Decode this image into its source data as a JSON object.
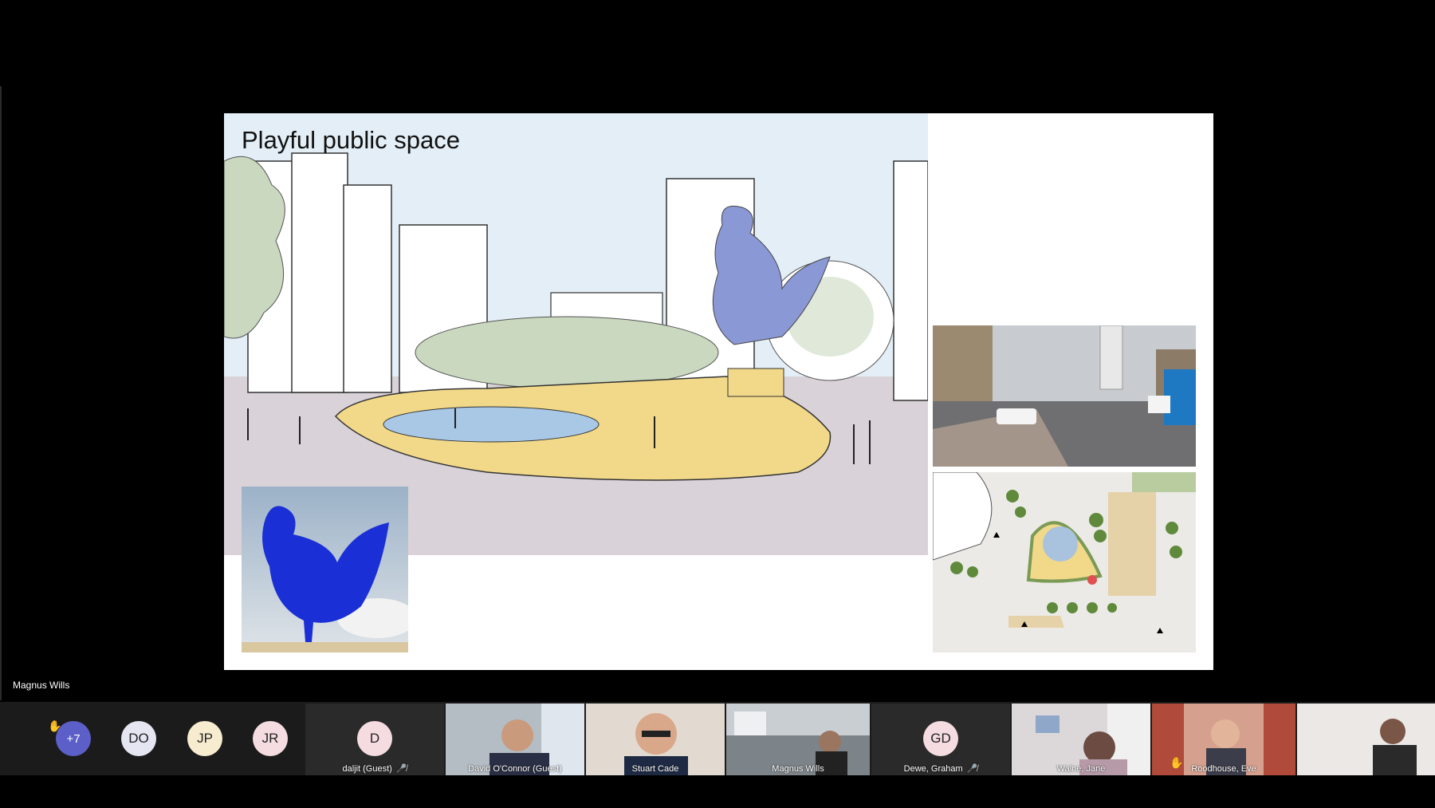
{
  "slide": {
    "title": "Playful public space"
  },
  "presenter_name": "Magnus Wills",
  "overflow_count": "+7",
  "avatars": [
    {
      "initials": "DO",
      "color": "#e6e6f3"
    },
    {
      "initials": "JP",
      "color": "#f7ecd0"
    },
    {
      "initials": "JR",
      "color": "#f5dce0"
    }
  ],
  "participants": [
    {
      "name": "daljit (Guest)",
      "initials": "D",
      "muted": true
    },
    {
      "name": "David O'Connor (Guest)"
    },
    {
      "name": "Stuart Cade"
    },
    {
      "name": "Magnus Wills"
    },
    {
      "name": "Dewe, Graham",
      "initials": "GD",
      "muted": true
    },
    {
      "name": "Walne, Jane"
    },
    {
      "name": "Roodhouse, Eve",
      "hand": true
    }
  ],
  "colors": {
    "accent_overflow": "#5b5fc7",
    "sculpture_blue": "#1a2fd6",
    "plaza_yellow": "#f2d98a",
    "sky": "#e3eef6",
    "tree_green": "#c9d8bf"
  }
}
